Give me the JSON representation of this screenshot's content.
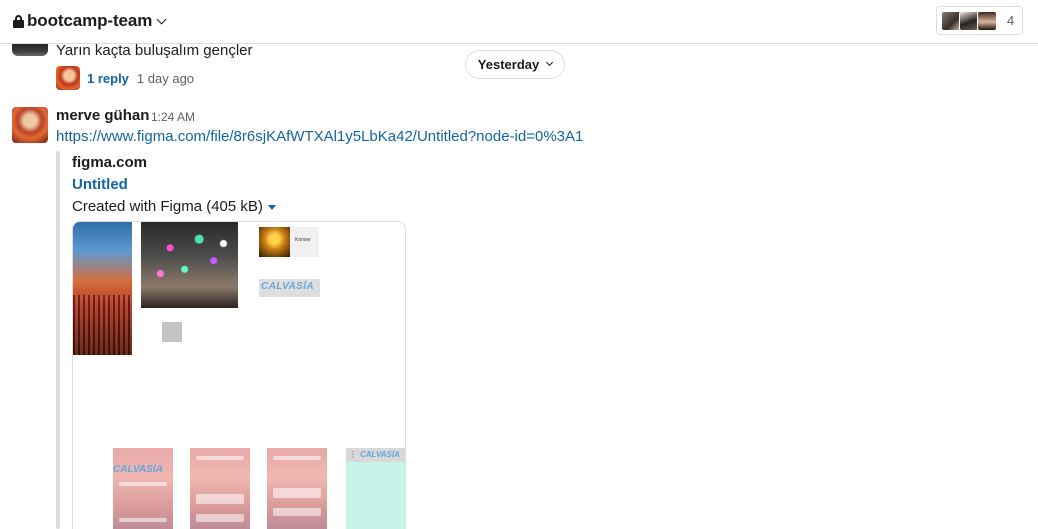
{
  "header": {
    "channel_name": "bootcamp-team",
    "member_count": "4"
  },
  "thread_message": {
    "text": "Yarın kaçta buluşalım gençler",
    "reply_count": "1 reply",
    "reply_time": "1 day ago"
  },
  "date_divider": {
    "label": "Yesterday"
  },
  "message": {
    "author": "merve gühan",
    "time": "1:24 AM",
    "link": "https://www.figma.com/file/8r6sjKAfWTXAl1y5LbKa42/Untitled?node-id=0%3A1",
    "unfurl": {
      "site": "figma.com",
      "title": "Untitled",
      "description": "Created with Figma (405 kB)"
    }
  },
  "preview": {
    "konser_label": "Konser",
    "brand_text": "CALVASİA",
    "phone_brand_text": "CALVASİA"
  },
  "colors": {
    "link": "#1264a3",
    "border": "#dddddd",
    "meta_text": "#616061"
  }
}
